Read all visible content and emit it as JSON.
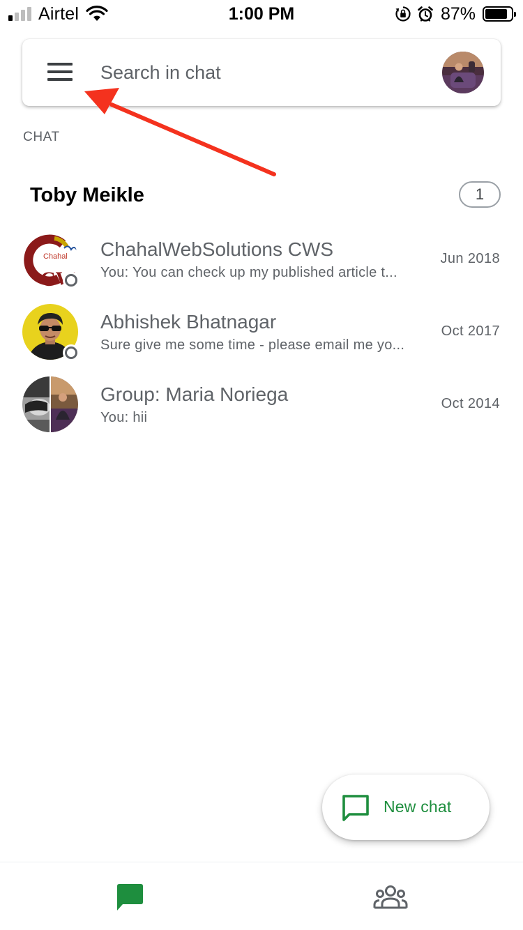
{
  "status_bar": {
    "carrier": "Airtel",
    "time": "1:00 PM",
    "battery_percent": "87%",
    "battery_level": 0.87
  },
  "search": {
    "placeholder": "Search in chat"
  },
  "section": {
    "label": "CHAT"
  },
  "account": {
    "name": "Toby Meikle",
    "count": "1"
  },
  "chats": [
    {
      "title": "ChahalWebSolutions CWS",
      "preview": "You: You can check up my published article t...",
      "date": "Jun 2018",
      "logo_text": "Chahal",
      "logo_letters": "CW"
    },
    {
      "title": "Abhishek Bhatnagar",
      "preview": "Sure give me some time - please email me yo...",
      "date": "Oct 2017"
    },
    {
      "title": "Group: Maria Noriega",
      "preview": "You: hii",
      "date": "Oct 2014"
    }
  ],
  "fab": {
    "label": "New chat"
  },
  "colors": {
    "accent_green": "#1e8e3e",
    "annotation_red": "#f4321e"
  },
  "icons": {
    "menu": "menu-icon",
    "new_chat": "chat-bubble-icon",
    "nav_chat": "chat-bubble-filled-icon",
    "nav_people": "people-icon"
  }
}
